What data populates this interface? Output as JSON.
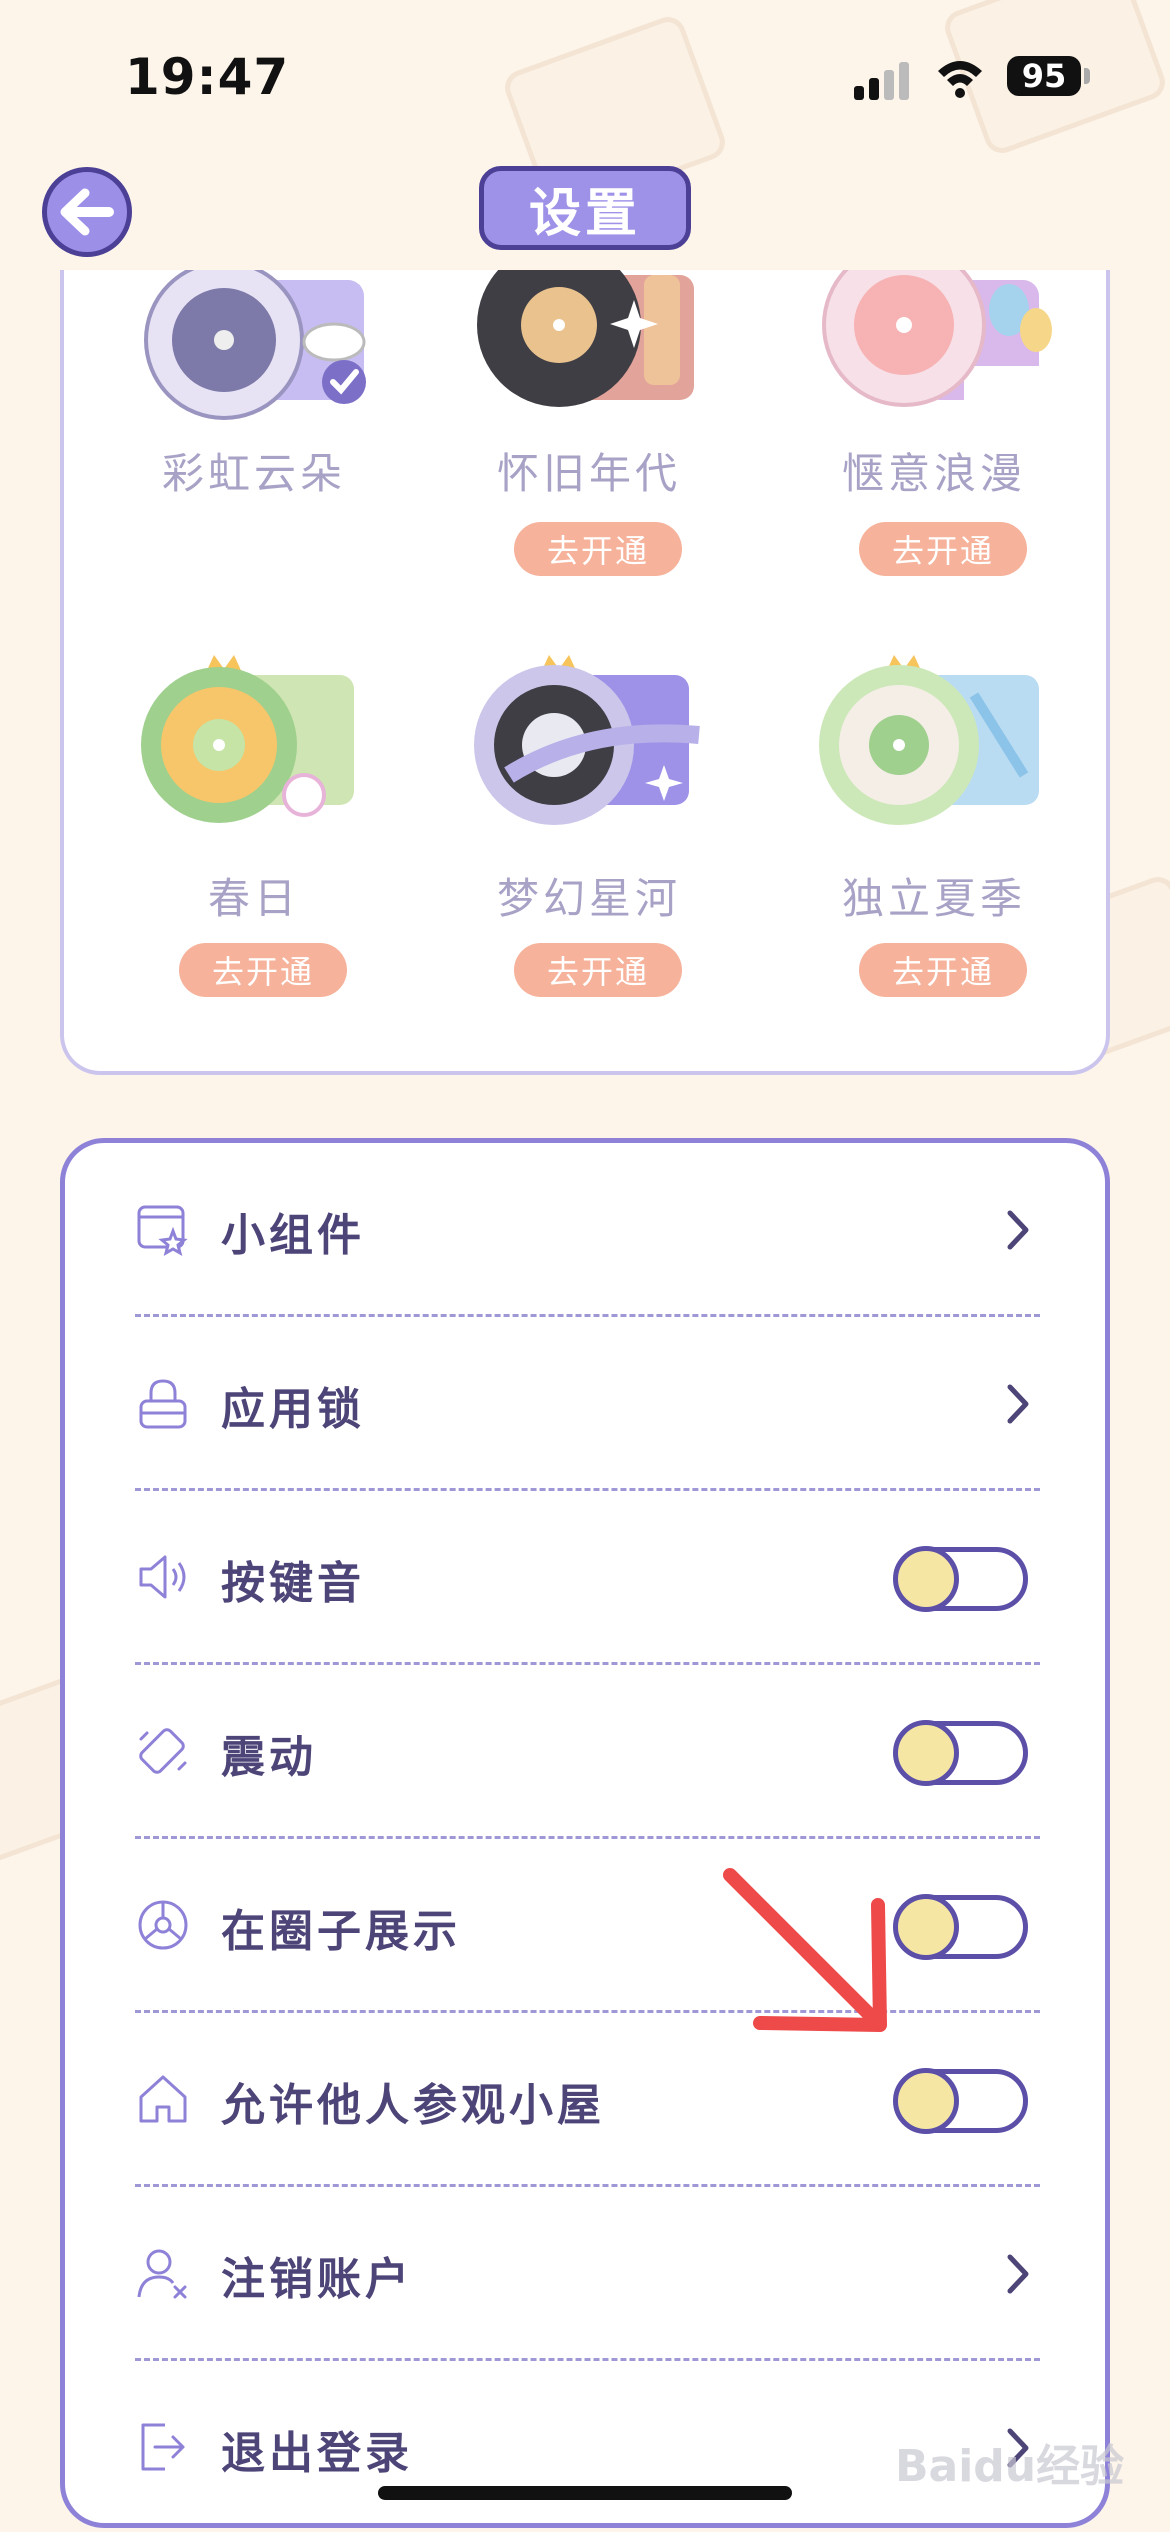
{
  "status_bar": {
    "time": "19:47",
    "battery": "95"
  },
  "header": {
    "title": "设置",
    "back_icon": "arrow-left-icon"
  },
  "themes": [
    {
      "name": "彩虹云朵",
      "selected": true
    },
    {
      "name": "怀旧年代",
      "action": "去开通"
    },
    {
      "name": "惬意浪漫",
      "action": "去开通"
    },
    {
      "name": "春日",
      "action": "去开通"
    },
    {
      "name": "梦幻星河",
      "action": "去开通"
    },
    {
      "name": "独立夏季",
      "action": "去开通"
    }
  ],
  "settings": [
    {
      "label": "小组件",
      "icon": "widget-icon",
      "control": "chevron"
    },
    {
      "label": "应用锁",
      "icon": "lock-icon",
      "control": "chevron"
    },
    {
      "label": "按键音",
      "icon": "speaker-icon",
      "control": "toggle",
      "on": false
    },
    {
      "label": "震动",
      "icon": "vibrate-icon",
      "control": "toggle",
      "on": false
    },
    {
      "label": "在圈子展示",
      "icon": "circle-icon",
      "control": "toggle",
      "on": false
    },
    {
      "label": "允许他人参观小屋",
      "icon": "house-icon",
      "control": "toggle",
      "on": false
    },
    {
      "label": "注销账户",
      "icon": "user-remove-icon",
      "control": "chevron"
    },
    {
      "label": "退出登录",
      "icon": "logout-icon",
      "control": "chevron"
    }
  ],
  "watermark": "Baidu经验",
  "colors": {
    "background": "#fdf5ea",
    "accent": "#9d92e8",
    "border": "#5b4fa8",
    "toggle_knob": "#f5e6a4",
    "activate_button": "#f6b29a",
    "annotation_arrow": "#ee4a4a"
  }
}
